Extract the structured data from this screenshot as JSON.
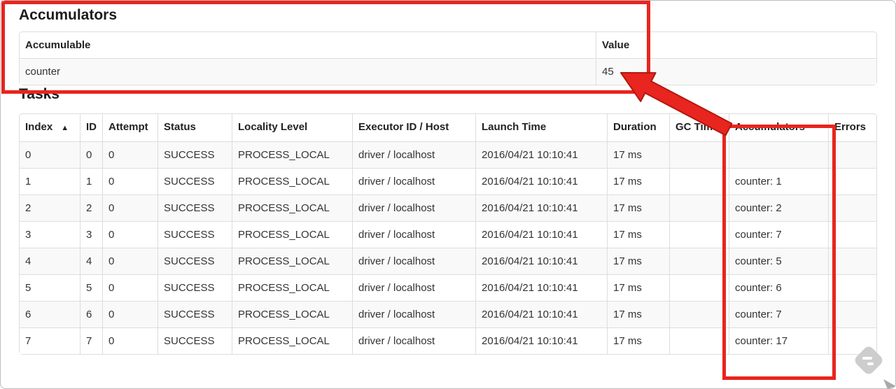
{
  "accumulators_section": {
    "title": "Accumulators",
    "table": {
      "headers": [
        "Accumulable",
        "Value"
      ],
      "rows": [
        [
          "counter",
          "45"
        ]
      ]
    }
  },
  "tasks_section": {
    "title": "Tasks",
    "table": {
      "headers": [
        "Index",
        "ID",
        "Attempt",
        "Status",
        "Locality Level",
        "Executor ID / Host",
        "Launch Time",
        "Duration",
        "GC Time",
        "Accumulators",
        "Errors"
      ],
      "sort_column": "Index",
      "sort_indicator": "▲",
      "rows": [
        [
          "0",
          "0",
          "0",
          "SUCCESS",
          "PROCESS_LOCAL",
          "driver / localhost",
          "2016/04/21 10:10:41",
          "17 ms",
          "",
          "",
          ""
        ],
        [
          "1",
          "1",
          "0",
          "SUCCESS",
          "PROCESS_LOCAL",
          "driver / localhost",
          "2016/04/21 10:10:41",
          "17 ms",
          "",
          "counter: 1",
          ""
        ],
        [
          "2",
          "2",
          "0",
          "SUCCESS",
          "PROCESS_LOCAL",
          "driver / localhost",
          "2016/04/21 10:10:41",
          "17 ms",
          "",
          "counter: 2",
          ""
        ],
        [
          "3",
          "3",
          "0",
          "SUCCESS",
          "PROCESS_LOCAL",
          "driver / localhost",
          "2016/04/21 10:10:41",
          "17 ms",
          "",
          "counter: 7",
          ""
        ],
        [
          "4",
          "4",
          "0",
          "SUCCESS",
          "PROCESS_LOCAL",
          "driver / localhost",
          "2016/04/21 10:10:41",
          "17 ms",
          "",
          "counter: 5",
          ""
        ],
        [
          "5",
          "5",
          "0",
          "SUCCESS",
          "PROCESS_LOCAL",
          "driver / localhost",
          "2016/04/21 10:10:41",
          "17 ms",
          "",
          "counter: 6",
          ""
        ],
        [
          "6",
          "6",
          "0",
          "SUCCESS",
          "PROCESS_LOCAL",
          "driver / localhost",
          "2016/04/21 10:10:41",
          "17 ms",
          "",
          "counter: 7",
          ""
        ],
        [
          "7",
          "7",
          "0",
          "SUCCESS",
          "PROCESS_LOCAL",
          "driver / localhost",
          "2016/04/21 10:10:41",
          "17 ms",
          "",
          "counter: 17",
          ""
        ]
      ]
    }
  },
  "annotations": {
    "highlight_color": "#e8251e",
    "arrow_outline_color": "#b3170e",
    "box_1_target": "Accumulators summary table",
    "box_2_target": "Accumulators column of Tasks table",
    "watermark_icon": "stamp-diamond-icon",
    "watermark_color": "#cdcdcd"
  }
}
